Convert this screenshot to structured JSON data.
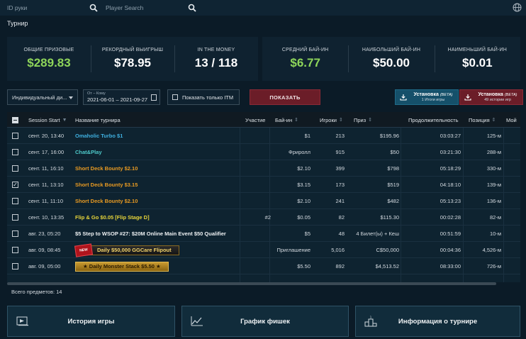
{
  "search": {
    "id_placeholder": "ID руки",
    "player_placeholder": "Player Search"
  },
  "section_title": "Турнир",
  "stats_left": [
    {
      "label": "ОБЩИЕ ПРИЗОВЫЕ",
      "value": "$289.83",
      "highlight": true
    },
    {
      "label": "РЕКОРДНЫЙ ВЫИГРЫШ",
      "value": "$78.95",
      "highlight": false
    },
    {
      "label": "IN THE MONEY",
      "value": "13 / 118",
      "highlight": false
    }
  ],
  "stats_right": [
    {
      "label": "СРЕДНИЙ БАЙ-ИН",
      "value": "$6.77",
      "highlight": true
    },
    {
      "label": "НАИБОЛЬШИЙ БАЙ-ИН",
      "value": "$50.00",
      "highlight": false
    },
    {
      "label": "НАИМЕНЬШИЙ БАЙ-ИН",
      "value": "$0.01",
      "highlight": false
    }
  ],
  "filters": {
    "type_value": "Индивидуальный ди...",
    "date_sublabel": "От – Кому",
    "date_range": "2021-06-01 – 2021-09-27",
    "itm_label": "Показать только ITM",
    "show_button": "ПОКАЗАТЬ",
    "install1_title": "Установка",
    "install1_beta": "(BETA)",
    "install1_sub": "1 Итоги игры",
    "install2_title": "Установка",
    "install2_beta": "(BETA)",
    "install2_sub": "49 истории игр"
  },
  "colors": {
    "accent_green": "#8ed55a",
    "button_red": "#6b1d28",
    "button_blue": "#15506a"
  },
  "table": {
    "headers": {
      "start": "Session Start",
      "name": "Название турнира",
      "participation": "Участие",
      "buyin": "Бай-ин",
      "players": "Игроки",
      "prize": "Приз",
      "duration": "Продолжительность",
      "position": "Позиция",
      "my": "Мой"
    },
    "rows": [
      {
        "checked": false,
        "start": "сент. 20, 13:40",
        "name": "Omaholic Turbo $1",
        "style": "blue",
        "participation": "",
        "buyin": "$1",
        "players": "213",
        "prize": "$195.96",
        "duration": "03:03:27",
        "position": "125-м"
      },
      {
        "checked": false,
        "start": "сент. 17, 16:00",
        "name": "Chat&Play",
        "style": "teal",
        "participation": "",
        "buyin": "Фриролл",
        "players": "915",
        "prize": "$50",
        "duration": "03:21:30",
        "position": "288-м"
      },
      {
        "checked": false,
        "start": "сент. 11, 16:10",
        "name": "Short Deck Bounty $2.10",
        "style": "orange",
        "participation": "",
        "buyin": "$2.10",
        "players": "399",
        "prize": "$798",
        "duration": "05:18:29",
        "position": "330-м"
      },
      {
        "checked": true,
        "start": "сент. 11, 13:10",
        "name": "Short Deck Bounty $3.15",
        "style": "orange",
        "participation": "",
        "buyin": "$3.15",
        "players": "173",
        "prize": "$519",
        "duration": "04:18:10",
        "position": "139-м"
      },
      {
        "checked": false,
        "start": "сент. 11, 11:10",
        "name": "Short Deck Bounty $2.10",
        "style": "orange",
        "participation": "",
        "buyin": "$2.10",
        "players": "241",
        "prize": "$482",
        "duration": "05:13:23",
        "position": "136-м"
      },
      {
        "checked": false,
        "start": "сент. 10, 13:35",
        "name": "Flip & Go $0.05 [Flip Stage D]",
        "style": "yellow",
        "participation": "#2",
        "buyin": "$0.05",
        "players": "82",
        "prize": "$115.30",
        "duration": "00:02:28",
        "position": "82-м"
      },
      {
        "checked": false,
        "start": "авг. 23, 05:20",
        "name": "$5 Step to WSOP #27: $20M Online Main Event $50 Qualifier",
        "style": "white",
        "participation": "",
        "buyin": "$5",
        "players": "48",
        "prize": "4 Билет(ы) + Кеш",
        "duration": "00:51:59",
        "position": "10-м"
      },
      {
        "checked": false,
        "start": "авг. 09, 08:45",
        "name": "Daily $50,000 GGCare Flipout",
        "style": "banner-gg",
        "badge": "NEW",
        "participation": "",
        "buyin": "Приглашение",
        "players": "5,016",
        "prize": "C$50,000",
        "duration": "00:04:36",
        "position": "4,526-м"
      },
      {
        "checked": false,
        "start": "авг. 09, 05:00",
        "name": "Daily Monster Stack $5.50",
        "style": "banner-ms",
        "participation": "",
        "buyin": "$5.50",
        "players": "892",
        "prize": "$4,513.52",
        "duration": "08:33:00",
        "position": "726-м"
      }
    ],
    "total": "Всего предметов: 14"
  },
  "bottom": {
    "history": "История игры",
    "chips": "График фишек",
    "info": "Информация о турнире"
  }
}
